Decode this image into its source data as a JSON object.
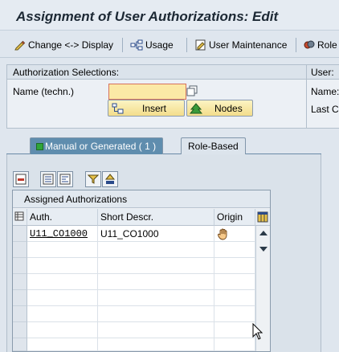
{
  "window": {
    "title": "Assignment of User Authorizations: Edit"
  },
  "toolbar": {
    "change_display_label": "Change <-> Display",
    "usage_label": "Usage",
    "user_maintenance_label": "User Maintenance",
    "role_label": "Role"
  },
  "selections": {
    "header": "Authorization Selections:",
    "name_label": "Name (techn.)",
    "name_value": "",
    "insert_label": "Insert",
    "nodes_label": "Nodes"
  },
  "user_panel": {
    "header": "User:",
    "name_label": "Name:",
    "last_label": "Last Cl"
  },
  "tabs": [
    {
      "label": "Manual or Generated ( 1 )",
      "active": true
    },
    {
      "label": "Role-Based",
      "active": false
    }
  ],
  "grid": {
    "title": "Assigned Authorizations",
    "columns": [
      "Auth.",
      "Short Descr.",
      "Origin"
    ],
    "rows": [
      {
        "auth": "U11_CO1000",
        "short_descr": "U11_CO1000",
        "origin_icon": "hand-icon"
      }
    ]
  },
  "colors": {
    "active_tab": "#5f8dae",
    "required_field": "#fbe9a6",
    "status_green": "#2fa63a"
  }
}
